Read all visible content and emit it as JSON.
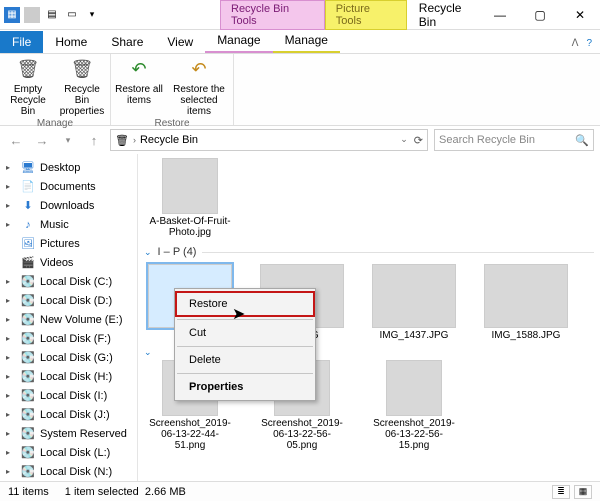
{
  "titlebar": {
    "context_tab_pink": "Recycle Bin Tools",
    "context_tab_yellow": "Picture Tools",
    "app_title": "Recycle Bin"
  },
  "tabs": {
    "file": "File",
    "home": "Home",
    "share": "Share",
    "view": "View",
    "manage_pink": "Manage",
    "manage_yellow": "Manage"
  },
  "ribbon": {
    "empty_bin": "Empty Recycle Bin",
    "bin_props": "Recycle Bin properties",
    "group_manage": "Manage",
    "restore_all": "Restore all items",
    "restore_sel": "Restore the selected items",
    "group_restore": "Restore"
  },
  "address": {
    "location": "Recycle Bin",
    "search_placeholder": "Search Recycle Bin"
  },
  "sidebar": [
    {
      "icon": "desktop",
      "label": "Desktop",
      "exp": "▸"
    },
    {
      "icon": "doc",
      "label": "Documents",
      "exp": "▸"
    },
    {
      "icon": "down",
      "label": "Downloads",
      "exp": "▸"
    },
    {
      "icon": "music",
      "label": "Music",
      "exp": "▸"
    },
    {
      "icon": "pic",
      "label": "Pictures",
      "exp": ""
    },
    {
      "icon": "vid",
      "label": "Videos",
      "exp": ""
    },
    {
      "icon": "disk",
      "label": "Local Disk (C:)",
      "exp": "▸"
    },
    {
      "icon": "disk",
      "label": "Local Disk (D:)",
      "exp": "▸"
    },
    {
      "icon": "disk",
      "label": "New Volume (E:)",
      "exp": "▸"
    },
    {
      "icon": "disk",
      "label": "Local Disk (F:)",
      "exp": "▸"
    },
    {
      "icon": "disk",
      "label": "Local Disk (G:)",
      "exp": "▸"
    },
    {
      "icon": "disk",
      "label": "Local Disk (H:)",
      "exp": "▸"
    },
    {
      "icon": "disk",
      "label": "Local Disk (I:)",
      "exp": "▸"
    },
    {
      "icon": "disk",
      "label": "Local Disk (J:)",
      "exp": "▸"
    },
    {
      "icon": "disk",
      "label": "System Reserved",
      "exp": "▸"
    },
    {
      "icon": "disk",
      "label": "Local Disk (L:)",
      "exp": "▸"
    },
    {
      "icon": "disk",
      "label": "Local Disk (N:)",
      "exp": "▸"
    }
  ],
  "groups": {
    "ip_header": "I – P (4)"
  },
  "files": {
    "fruit": "A-Basket-Of-Fruit-Photo.jpg",
    "img02": "02.JPG",
    "img1437": "IMG_1437.JPG",
    "img1588": "IMG_1588.JPG",
    "scr1": "Screenshot_2019-06-13-22-44-51.png",
    "scr2": "Screenshot_2019-06-13-22-56-05.png",
    "scr3": "Screenshot_2019-06-13-22-56-15.png"
  },
  "context_menu": {
    "restore": "Restore",
    "cut": "Cut",
    "delete": "Delete",
    "properties": "Properties"
  },
  "status": {
    "count": "11 items",
    "selection": "1 item selected",
    "size": "2.66 MB"
  }
}
